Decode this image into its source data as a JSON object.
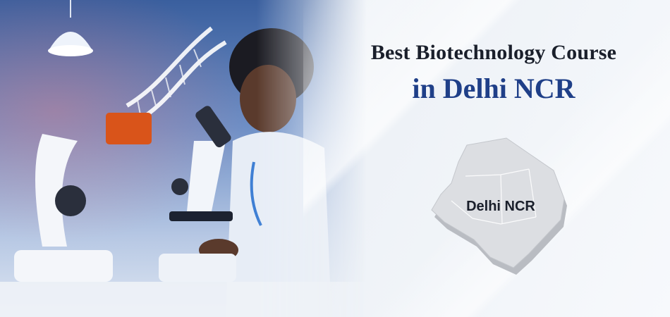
{
  "headline": {
    "line1": "Best Biotechnology Course",
    "line2": "in Delhi NCR"
  },
  "map": {
    "label": "Delhi NCR"
  },
  "colors": {
    "title_dark": "#1a1f2b",
    "title_accent": "#1f3f88",
    "map_fill": "#d9dbdf",
    "map_side": "#b9bcc2"
  },
  "icons": [
    "dna-helix-icon",
    "microscope-icon",
    "pendant-lamp-icon"
  ]
}
